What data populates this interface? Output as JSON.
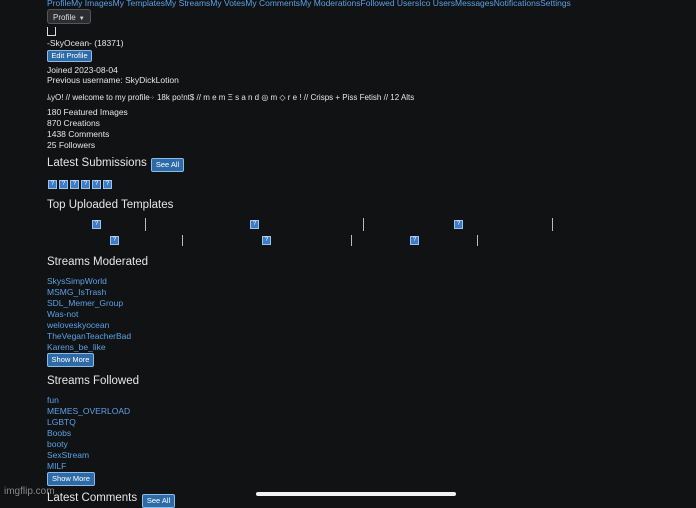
{
  "nav": {
    "items": [
      "Profile",
      "My Images",
      "My Templates",
      "My Streams",
      "My Votes",
      "My Comments",
      "My Moderations",
      "Followed Users",
      "Ico Users",
      "Messages",
      "Notifications",
      "Settings"
    ]
  },
  "profile_dropdown": {
    "label": "Profile",
    "caret": "▼"
  },
  "user": {
    "name_line": "-SkyOcean- (18371)",
    "edit_label": "Edit Profile",
    "joined": "Joined 2023-08-04",
    "previous_username": "Previous username: SkyDickLotion",
    "bio_start": "ﾑyO",
    "bio_mid": "! // welcome to my profile",
    "bio_end": " 18k po!nt$ // m e m Ξ s   a n d  ◎ m ◇  r  e  !  // Crisps + Piss Fetish // 12 Alts",
    "stats": [
      "180 Featured Images",
      "870 Creations",
      "1438 Comments",
      "25 Followers"
    ]
  },
  "latest_submissions": {
    "title": "Latest Submissions",
    "see_all": "See All",
    "thumb_glyph": "?"
  },
  "top_templates": {
    "title": "Top Uploaded Templates",
    "icon_glyph": "?"
  },
  "streams_moderated": {
    "title": "Streams Moderated",
    "items": [
      "SkysSimpWorld",
      "MSMG_IsTrash",
      "SDL_Memer_Group",
      "Was-not",
      "weloveskyocean",
      "TheVeganTeacherBad",
      "Karens_be_like"
    ],
    "show_more": "Show More"
  },
  "streams_followed": {
    "title": "Streams Followed",
    "items": [
      "fun",
      "MEMES_OVERLOAD",
      "LGBTQ",
      "Boobs",
      "booty",
      "SexStream",
      "MILF"
    ],
    "show_more": "Show More"
  },
  "latest_comments": {
    "title": "Latest Comments",
    "see_all": "See All"
  },
  "watermark": "imgflip.com"
}
